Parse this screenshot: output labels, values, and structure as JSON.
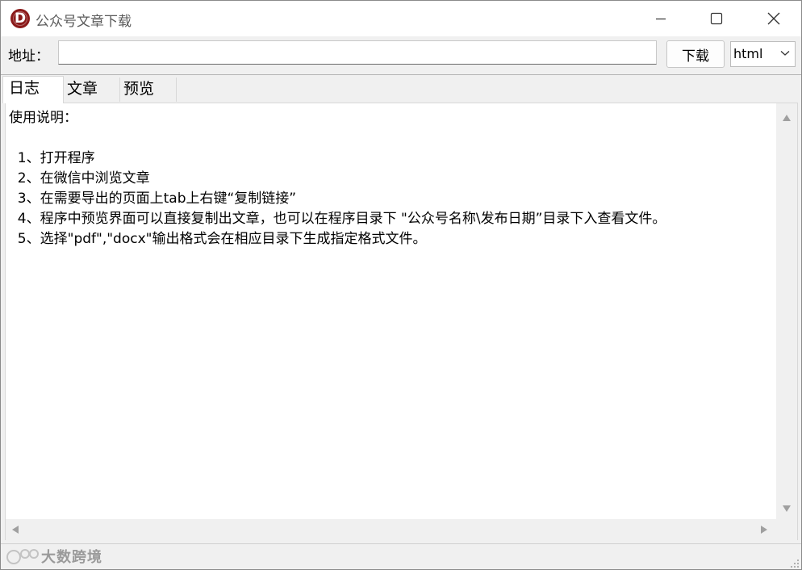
{
  "window": {
    "title": "公众号文章下载",
    "app_icon_letter": "D",
    "app_icon_color": "#8b1a1a"
  },
  "toolbar": {
    "address_label": "地址：",
    "address_value": "",
    "download_label": "下载",
    "format_selected": "html"
  },
  "tabs": [
    {
      "label": "日志",
      "active": true
    },
    {
      "label": "文章",
      "active": false
    },
    {
      "label": "预览",
      "active": false
    }
  ],
  "log": {
    "lines": [
      "使用说明：",
      "",
      "  1、打开程序",
      "  2、在微信中浏览文章",
      "  3、在需要导出的页面上tab上右键“复制链接”",
      "  4、程序中预览界面可以直接复制出文章，也可以在程序目录下 \"公众号名称\\发布日期”目录下入查看文件。",
      "  5、选择\"pdf\",\"docx\"输出格式会在相应目录下生成指定格式文件。"
    ]
  },
  "statusbar": {
    "watermark_text": "大数跨境"
  },
  "icons": {
    "minimize": "minimize-icon",
    "maximize": "maximize-icon",
    "close": "close-icon",
    "dropdown": "chevron-down-icon"
  }
}
